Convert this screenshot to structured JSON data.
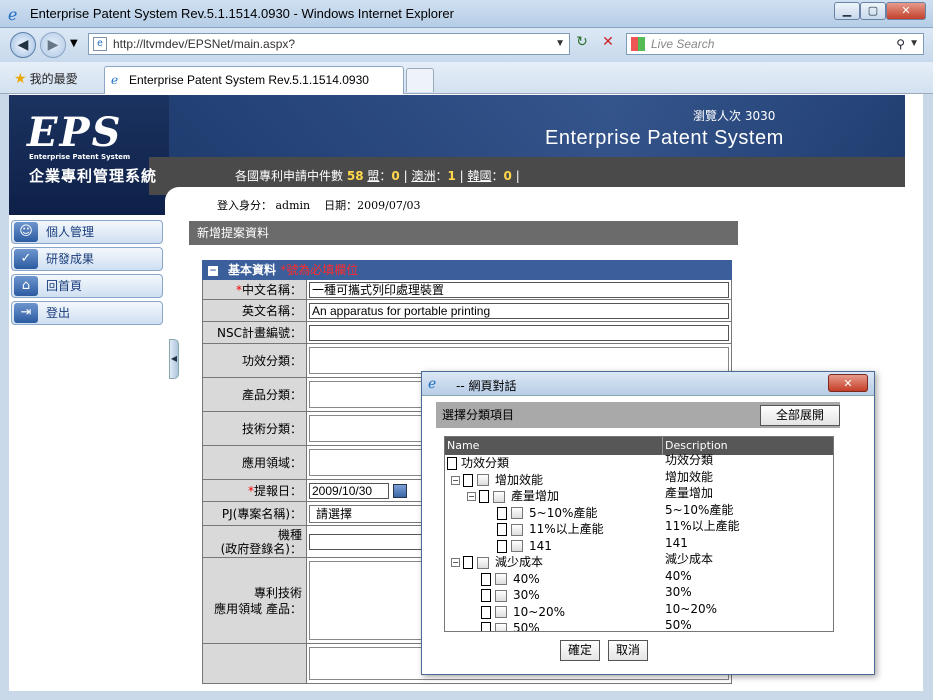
{
  "browser": {
    "window_title": "Enterprise Patent System Rev.5.1.1514.0930 - Windows Internet Explorer",
    "address": "http://ltvmdev/EPSNet/main.aspx?",
    "search_placeholder": "Live Search",
    "favorites_label": "我的最愛",
    "tab_title": "Enterprise Patent System Rev.5.1.1514.0930",
    "minimize_icon": "minimize-icon",
    "maximize_icon": "maximize-icon",
    "close_icon": "close-icon"
  },
  "banner": {
    "logo_text": "EPS",
    "logo_sub": "Enterprise Patent System",
    "logo_cn": "企業專利管理系統",
    "visits_label": "瀏覽人次",
    "visits_count": "3030",
    "system_title": "Enterprise Patent System",
    "stats_prefix": "各國專利申請中件數",
    "stats_total": "58",
    "stats_region1": "盟",
    "stats_region1_count": "0",
    "stats_region2": "澳洲",
    "stats_region2_count": "1",
    "stats_region3": "韓國",
    "stats_region3_count": "0"
  },
  "login": {
    "label": "登入身分：",
    "user": "admin",
    "date_label": "日期：",
    "date": "2009/07/03"
  },
  "menu": [
    {
      "label": "個人管理",
      "icon": "person-icon"
    },
    {
      "label": "研發成果",
      "icon": "thumb-up-icon"
    },
    {
      "label": "回首頁",
      "icon": "home-icon"
    },
    {
      "label": "登出",
      "icon": "logout-icon"
    }
  ],
  "page": {
    "section_title": "新增提案資料",
    "form_title": "基本資料",
    "required_note": "*號為必填欄位",
    "fields": {
      "cn_name_label": "中文名稱：",
      "cn_name_value": "一種可攜式列印處理裝置",
      "en_name_label": "英文名稱：",
      "en_name_value": "An apparatus for portable printing",
      "nsc_label": "NSC計畫編號：",
      "efficacy_label": "功效分類：",
      "product_label": "產品分類：",
      "tech_label": "技術分類：",
      "field_label": "應用領域：",
      "report_date_label": "提報日：",
      "report_date_value": "2009/10/30",
      "pj_label": "PJ(專案名稱)：",
      "pj_value": "請選擇",
      "model_label_1": "機種",
      "model_label_2": "(政府登錄名)：",
      "app_label_1": "專利技術",
      "app_label_2": "應用領域 產品："
    }
  },
  "dialog": {
    "title": "-- 網頁對話",
    "header": "選擇分類項目",
    "expand_all": "全部展開",
    "col_name": "Name",
    "col_desc": "Description",
    "ok": "確定",
    "cancel": "取消",
    "rows": [
      {
        "name": "功效分類",
        "desc": "功效分類"
      },
      {
        "name": "增加效能",
        "desc": "增加效能"
      },
      {
        "name": "產量增加",
        "desc": "產量增加"
      },
      {
        "name": "5~10%產能",
        "desc": "5~10%產能"
      },
      {
        "name": "11%以上產能",
        "desc": "11%以上產能"
      },
      {
        "name": "141",
        "desc": "141"
      },
      {
        "name": "減少成本",
        "desc": "減少成本"
      },
      {
        "name": "40%",
        "desc": "40%"
      },
      {
        "name": "30%",
        "desc": "30%"
      },
      {
        "name": "10~20%",
        "desc": "10~20%"
      },
      {
        "name": "50%",
        "desc": "50%"
      }
    ]
  }
}
